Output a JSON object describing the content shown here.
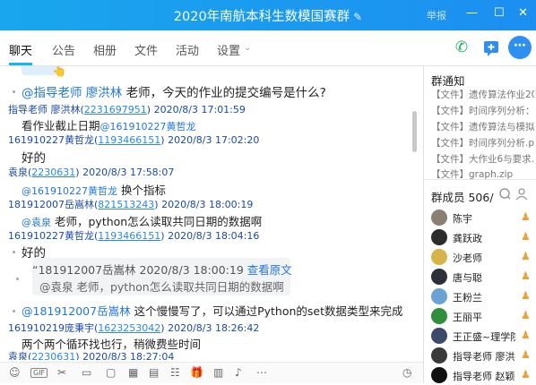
{
  "window": {
    "title": "2020年南航本科生数模国赛群",
    "report": "举报",
    "min": "—",
    "restore": "☐",
    "close": "✕"
  },
  "tabs": [
    "聊天",
    "公告",
    "相册",
    "文件",
    "活动",
    "设置"
  ],
  "chat": {
    "l1_mention": "@指导老师 廖洪林",
    "l1_text": "老师，今天的作业的提交编号是什么?",
    "l2_nick": "指导老师 廖洪林(",
    "l2_id": "2231697951",
    "l2_time": ") 2020/8/3 17:01:59",
    "l3_text": "看作业截止日期",
    "l3_mention": "@161910227黄哲龙",
    "l4_nick": "161910227黄哲龙(",
    "l4_id": "1193466151",
    "l4_time": ") 2020/8/3 17:02:20",
    "l5_text": "好的",
    "l6_nick": "袁泉(",
    "l6_id": "2230631",
    "l6_time": ") 2020/8/3 17:58:07",
    "l7_mention": "@161910227黄哲龙",
    "l7_text": "换个指标",
    "l8_nick": "181912007岳嵩林(",
    "l8_id": "821513243",
    "l8_time": ") 2020/8/3 18:00:19",
    "l9_mention": "@袁泉",
    "l9_text": "老师，python怎么读取共同日期的数据啊",
    "l10_nick": "161910227黄哲龙(",
    "l10_id": "1193466151",
    "l10_time": ") 2020/8/3 18:04:16",
    "l11_text": "好的",
    "q_head": "“181912007岳嵩林  2020/8/3 18:00:19",
    "q_link": "查看原文",
    "q_body": "@袁泉 老师，python怎么读取共同日期的数据啊",
    "l12_mention": "@181912007岳嵩林",
    "l12_text": "这个慢慢写了，可以通过Python的set数据类型来完成",
    "l13_nick": "161910219庞秉宇(",
    "l13_id": "1623253042",
    "l13_time": ") 2020/8/3 18:26:42",
    "l14_text": "两个两个循环找也行，稍微费些时间",
    "l15_nick": "袁泉(",
    "l15_id": "2230631",
    "l15_time": ") 2020/8/3 18:27:04"
  },
  "toolbar": [
    "☺",
    "GIF",
    "✂",
    "▭",
    "▢",
    "▦",
    "▤",
    "☷",
    "🎁",
    "▥",
    "♪",
    "⋯",
    "◷"
  ],
  "notice": {
    "title": "群通知",
    "items": [
      "【文件】遗传算法作业20",
      "【文件】时间序列分析：",
      "【文件】遗传算法与模拟",
      "【文件】时间序列分析.pdf",
      "【文件】大作业6与要求.d",
      "【文件】graph.zip"
    ]
  },
  "members": {
    "title": "群成员 506/",
    "list": [
      {
        "name": "陈宇",
        "color": "#8a7f73"
      },
      {
        "name": "龚跃政",
        "color": "#2c2c2c"
      },
      {
        "name": "沙老师",
        "color": "#d7b44a"
      },
      {
        "name": "唐与聪",
        "color": "#2b2f38"
      },
      {
        "name": "王粉兰",
        "color": "#6aa2d6"
      },
      {
        "name": "王丽平",
        "color": "#2f8f3a"
      },
      {
        "name": "王正盛~理学院",
        "color": "#3c4b6a"
      },
      {
        "name": "指导老师 廖洪",
        "color": "#3a3a3a"
      },
      {
        "name": "指导老师 赵颖",
        "color": "#111111"
      }
    ]
  },
  "colors": {
    "accent": "#12b7f5",
    "titlebar": "#1c9cf0",
    "link": "#2b88e6"
  }
}
